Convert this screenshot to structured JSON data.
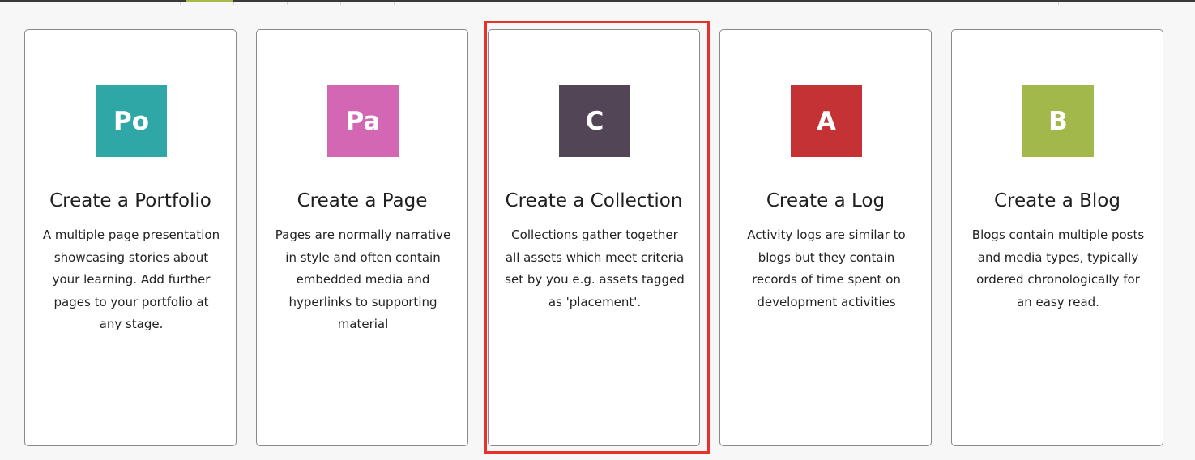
{
  "cards": [
    {
      "tile_text": "Po",
      "tile_color": "#2fa7a7",
      "title": "Create a Portfolio",
      "description": "A multiple page presentation showcasing stories about your learning. Add further pages to your portfolio at any stage."
    },
    {
      "tile_text": "Pa",
      "tile_color": "#d467b3",
      "title": "Create a Page",
      "description": "Pages are normally narrative in style and often contain embedded media and hyperlinks to supporting material"
    },
    {
      "tile_text": "C",
      "tile_color": "#524555",
      "title": "Create a Collection",
      "description": "Collections gather together all assets which meet criteria set by you e.g. assets tagged as 'placement'."
    },
    {
      "tile_text": "A",
      "tile_color": "#c53236",
      "title": "Create a Log",
      "description": "Activity logs are similar to blogs but they contain records of time spent on development activities"
    },
    {
      "tile_text": "B",
      "tile_color": "#a3b84b",
      "title": "Create a Blog",
      "description": "Blogs contain multiple posts and media types, typically ordered chronologically for an easy read."
    }
  ],
  "highlight_color": "#e8312a"
}
